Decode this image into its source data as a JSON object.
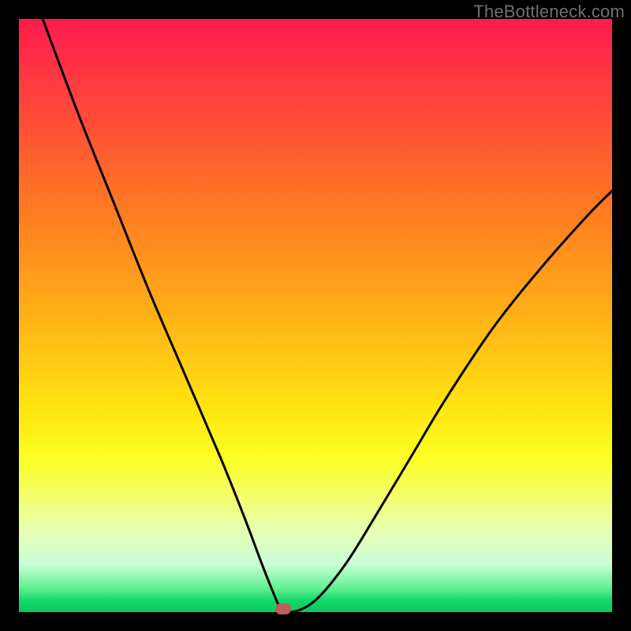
{
  "watermark": "TheBottleneck.com",
  "chart_data": {
    "type": "line",
    "title": "",
    "xlabel": "",
    "ylabel": "",
    "xlim": [
      0,
      100
    ],
    "ylim": [
      0,
      100
    ],
    "grid": false,
    "legend": false,
    "series": [
      {
        "name": "bottleneck-curve",
        "x": [
          4,
          10,
          16,
          22,
          28,
          34,
          38,
          41,
          43,
          44,
          46,
          50,
          55,
          60,
          66,
          72,
          80,
          88,
          96,
          100
        ],
        "y": [
          100,
          84,
          69,
          54,
          40,
          26,
          16,
          8,
          3,
          1,
          0,
          2,
          8,
          16,
          26,
          36,
          48,
          58,
          67,
          71
        ]
      }
    ],
    "marker": {
      "x": 44.5,
      "y": 0.5
    },
    "background_gradient": {
      "top": "#ff1a4d",
      "mid": "#ffe60f",
      "bottom": "#08c85e"
    }
  }
}
